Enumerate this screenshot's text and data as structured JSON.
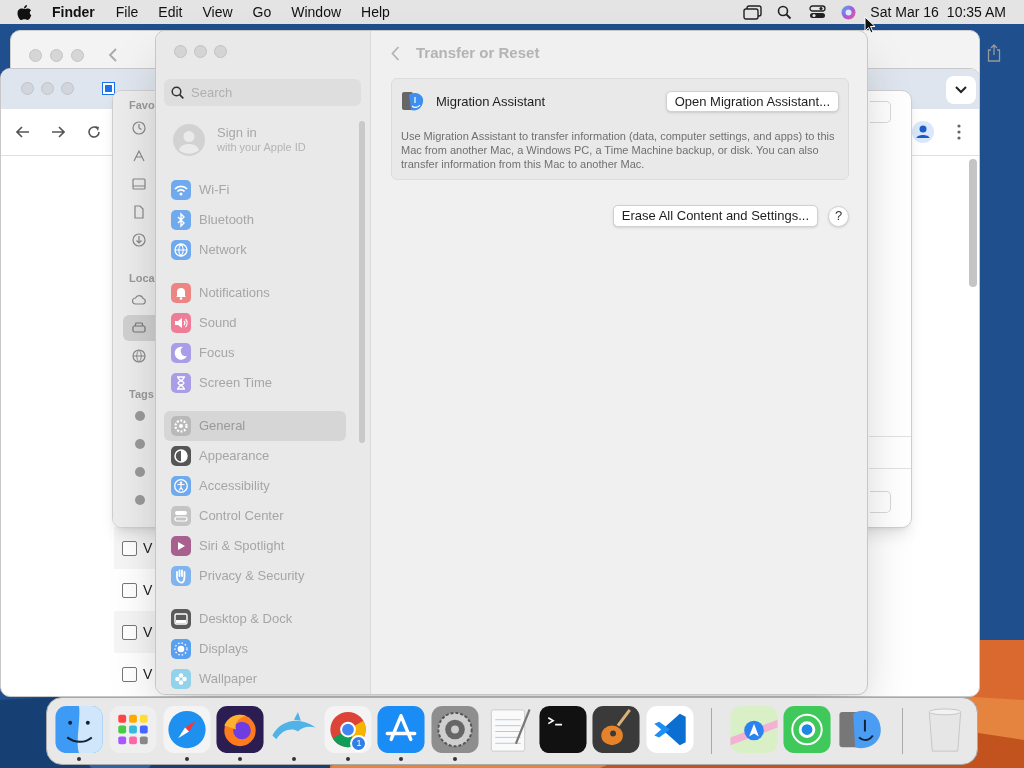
{
  "menu_bar": {
    "app": "Finder",
    "menus": [
      "File",
      "Edit",
      "View",
      "Go",
      "Window",
      "Help"
    ],
    "date": "Sat Mar 16",
    "time": "10:35 AM"
  },
  "finder_window": {
    "sidebar_headings": [
      "Favo",
      "Loca",
      "Tags"
    ],
    "locations": [
      {
        "kind": "cloud",
        "selected": false
      },
      {
        "kind": "drive",
        "selected": true
      },
      {
        "kind": "globe",
        "selected": false
      }
    ]
  },
  "browser_window": {
    "rows": [
      {
        "text": "V",
        "checked": false
      },
      {
        "text": "V",
        "checked": false
      },
      {
        "text": "V",
        "checked": false
      },
      {
        "text": "V",
        "checked": false
      }
    ]
  },
  "settings": {
    "search": {
      "placeholder": "Search"
    },
    "account": {
      "title": "Sign in",
      "subtitle": "with your Apple ID"
    },
    "groups": [
      [
        {
          "label": "Wi-Fi",
          "kind": "wifi",
          "color": "#6fa9ee",
          "selected": false
        },
        {
          "label": "Bluetooth",
          "kind": "bluetooth",
          "color": "#6fa9ee",
          "selected": false
        },
        {
          "label": "Network",
          "kind": "network",
          "color": "#6fa9ee",
          "selected": false
        }
      ],
      [
        {
          "label": "Notifications",
          "kind": "notifications",
          "color": "#ee8585",
          "selected": false
        },
        {
          "label": "Sound",
          "kind": "sound",
          "color": "#ee7e98",
          "selected": false
        },
        {
          "label": "Focus",
          "kind": "focus",
          "color": "#a99de8",
          "selected": false
        },
        {
          "label": "Screen Time",
          "kind": "screentime",
          "color": "#a99de8",
          "selected": false
        }
      ],
      [
        {
          "label": "General",
          "kind": "general",
          "color": "#b9b9b9",
          "selected": true
        },
        {
          "label": "Appearance",
          "kind": "appearance",
          "color": "#555555",
          "selected": false
        },
        {
          "label": "Accessibility",
          "kind": "accessibility",
          "color": "#6fa9ee",
          "selected": false
        },
        {
          "label": "Control Center",
          "kind": "controlcenter",
          "color": "#c4c4c4",
          "selected": false
        },
        {
          "label": "Siri & Spotlight",
          "kind": "siri",
          "color": "#a8608e",
          "selected": false
        },
        {
          "label": "Privacy & Security",
          "kind": "privacy",
          "color": "#7fb4f0",
          "selected": false
        }
      ],
      [
        {
          "label": "Desktop & Dock",
          "kind": "dock",
          "color": "#5a5a5a",
          "selected": false
        },
        {
          "label": "Displays",
          "kind": "displays",
          "color": "#5aa0f0",
          "selected": false
        },
        {
          "label": "Wallpaper",
          "kind": "wallpaper",
          "color": "#92d2ea",
          "selected": false
        }
      ]
    ],
    "page_title": "Transfer or Reset",
    "migration": {
      "title": "Migration Assistant",
      "button": "Open Migration Assistant...",
      "description": "Use Migration Assistant to transfer information (data, computer settings, and apps) to this Mac from another Mac, a Windows PC, a Time Machine backup, or disk. You can also transfer information from this Mac to another Mac."
    },
    "erase_button": "Erase All Content and Settings...",
    "help_button": "?"
  },
  "dock": {
    "apps": [
      {
        "kind": "finder",
        "running": true
      },
      {
        "kind": "launchpad",
        "running": false
      },
      {
        "kind": "safari",
        "running": true
      },
      {
        "kind": "firefox",
        "running": true
      },
      {
        "kind": "dolphin",
        "running": true
      },
      {
        "kind": "chrome",
        "running": true,
        "badge": "1"
      },
      {
        "kind": "appstore",
        "running": true
      },
      {
        "kind": "settings",
        "running": true
      },
      {
        "kind": "textedit",
        "running": false
      },
      {
        "kind": "terminal",
        "running": false
      },
      {
        "kind": "garageband",
        "running": false
      },
      {
        "kind": "vscode",
        "running": false
      },
      {
        "kind": "separator"
      },
      {
        "kind": "maps",
        "running": false
      },
      {
        "kind": "findmy",
        "running": false
      },
      {
        "kind": "migration",
        "running": false
      },
      {
        "kind": "separator"
      },
      {
        "kind": "trash",
        "running": false
      }
    ]
  }
}
